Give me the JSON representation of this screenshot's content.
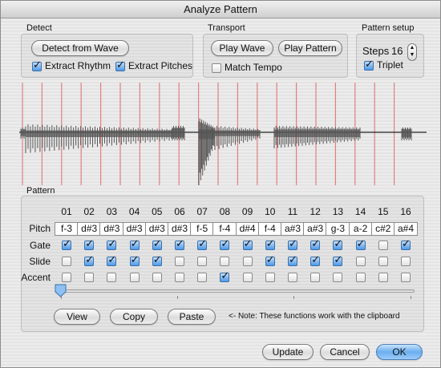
{
  "window": {
    "title": "Analyze Pattern"
  },
  "detect": {
    "label": "Detect",
    "detect_button": "Detect from Wave",
    "extract_rhythm": {
      "label": "Extract Rhythm",
      "checked": true
    },
    "extract_pitches": {
      "label": "Extract Pitches",
      "checked": true
    }
  },
  "transport": {
    "label": "Transport",
    "play_wave": "Play Wave",
    "play_pattern": "Play Pattern",
    "match_tempo": {
      "label": "Match Tempo",
      "checked": false
    }
  },
  "pattern_setup": {
    "label": "Pattern setup",
    "steps_label": "Steps",
    "steps_value": "16",
    "triplet": {
      "label": "Triplet",
      "checked": true
    }
  },
  "pattern": {
    "label": "Pattern",
    "row_labels": {
      "pitch": "Pitch",
      "gate": "Gate",
      "slide": "Slide",
      "accent": "Accent"
    },
    "steps": [
      {
        "num": "01",
        "pitch": "f-3",
        "gate": true,
        "slide": false,
        "accent": false
      },
      {
        "num": "02",
        "pitch": "d#3",
        "gate": true,
        "slide": true,
        "accent": false
      },
      {
        "num": "03",
        "pitch": "d#3",
        "gate": true,
        "slide": true,
        "accent": false
      },
      {
        "num": "04",
        "pitch": "d#3",
        "gate": true,
        "slide": true,
        "accent": false
      },
      {
        "num": "05",
        "pitch": "d#3",
        "gate": true,
        "slide": true,
        "accent": false
      },
      {
        "num": "06",
        "pitch": "d#3",
        "gate": true,
        "slide": false,
        "accent": false
      },
      {
        "num": "07",
        "pitch": "f-5",
        "gate": true,
        "slide": false,
        "accent": false
      },
      {
        "num": "08",
        "pitch": "f-4",
        "gate": true,
        "slide": false,
        "accent": true
      },
      {
        "num": "09",
        "pitch": "d#4",
        "gate": true,
        "slide": false,
        "accent": false
      },
      {
        "num": "10",
        "pitch": "f-4",
        "gate": true,
        "slide": true,
        "accent": false
      },
      {
        "num": "11",
        "pitch": "a#3",
        "gate": true,
        "slide": true,
        "accent": false
      },
      {
        "num": "12",
        "pitch": "a#3",
        "gate": true,
        "slide": true,
        "accent": false
      },
      {
        "num": "13",
        "pitch": "g-3",
        "gate": true,
        "slide": true,
        "accent": false
      },
      {
        "num": "14",
        "pitch": "a-2",
        "gate": true,
        "slide": false,
        "accent": false
      },
      {
        "num": "15",
        "pitch": "c#2",
        "gate": false,
        "slide": false,
        "accent": false
      },
      {
        "num": "16",
        "pitch": "a#4",
        "gate": true,
        "slide": false,
        "accent": false
      }
    ],
    "scroll_position": 0
  },
  "clipboard": {
    "view": "View",
    "copy": "Copy",
    "paste": "Paste",
    "note": "<- Note: These functions work with the clipboard"
  },
  "footer": {
    "update": "Update",
    "cancel": "Cancel",
    "ok": "OK"
  },
  "colors": {
    "accent_blue": "#4e9ae8",
    "marker_red": "#e08080",
    "wave_fill": "#555555"
  }
}
